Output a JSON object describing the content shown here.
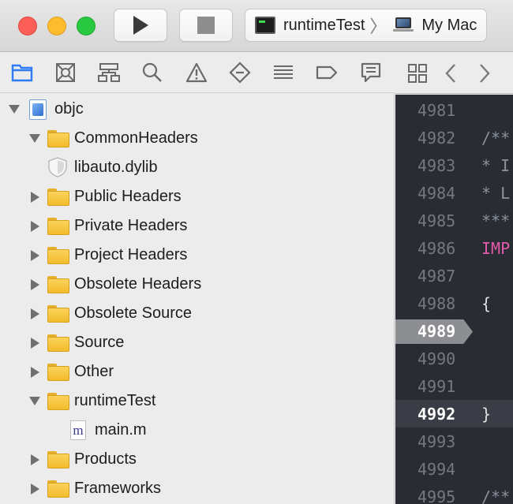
{
  "toolbar": {
    "scheme_name": "runtimeTest",
    "destination": "My Mac"
  },
  "navigator_tabs": [
    {
      "icon": "folder-icon",
      "selected": true
    },
    {
      "icon": "source-control-icon"
    },
    {
      "icon": "symbol-hierarchy-icon"
    },
    {
      "icon": "search-icon"
    },
    {
      "icon": "warning-icon"
    },
    {
      "icon": "test-diamond-icon"
    },
    {
      "icon": "debug-list-icon"
    },
    {
      "icon": "breakpoint-tag-icon"
    },
    {
      "icon": "report-bubble-icon"
    }
  ],
  "tree": {
    "items": [
      {
        "label": "objc",
        "type": "project",
        "expanded": true
      },
      {
        "label": "CommonHeaders",
        "type": "folder",
        "expanded": true
      },
      {
        "label": "libauto.dylib",
        "type": "library"
      },
      {
        "label": "Public Headers",
        "type": "folder",
        "expanded": false
      },
      {
        "label": "Private Headers",
        "type": "folder",
        "expanded": false
      },
      {
        "label": "Project Headers",
        "type": "folder",
        "expanded": false
      },
      {
        "label": "Obsolete Headers",
        "type": "folder",
        "expanded": false
      },
      {
        "label": "Obsolete Source",
        "type": "folder",
        "expanded": false
      },
      {
        "label": "Source",
        "type": "folder",
        "expanded": false
      },
      {
        "label": "Other",
        "type": "folder",
        "expanded": false
      },
      {
        "label": "runtimeTest",
        "type": "folder",
        "expanded": true
      },
      {
        "label": "main.m",
        "type": "source-file",
        "file_glyph": "m"
      },
      {
        "label": "Products",
        "type": "folder",
        "expanded": false
      },
      {
        "label": "Frameworks",
        "type": "folder",
        "expanded": false
      }
    ]
  },
  "editor": {
    "lines": [
      {
        "number": "4981",
        "code": ""
      },
      {
        "number": "4982",
        "code": "/**",
        "style": "comment"
      },
      {
        "number": "4983",
        "code": "* I",
        "style": "comment"
      },
      {
        "number": "4984",
        "code": "* L",
        "style": "comment"
      },
      {
        "number": "4985",
        "code": "***",
        "style": "comment"
      },
      {
        "number": "4986",
        "code": "IMP",
        "style": "macro"
      },
      {
        "number": "4987",
        "code": ""
      },
      {
        "number": "4988",
        "code": "{"
      },
      {
        "number": "4989",
        "code": "",
        "breakpoint": true
      },
      {
        "number": "4990",
        "code": ""
      },
      {
        "number": "4991",
        "code": ""
      },
      {
        "number": "4992",
        "code": "}",
        "current": true
      },
      {
        "number": "4993",
        "code": ""
      },
      {
        "number": "4994",
        "code": ""
      },
      {
        "number": "4995",
        "code": "/**",
        "style": "comment"
      }
    ]
  },
  "colors": {
    "accent": "#2f7bf5",
    "editor_bg": "#2a2c33",
    "folder": "#f5c23a",
    "macro": "#e25ba8"
  }
}
